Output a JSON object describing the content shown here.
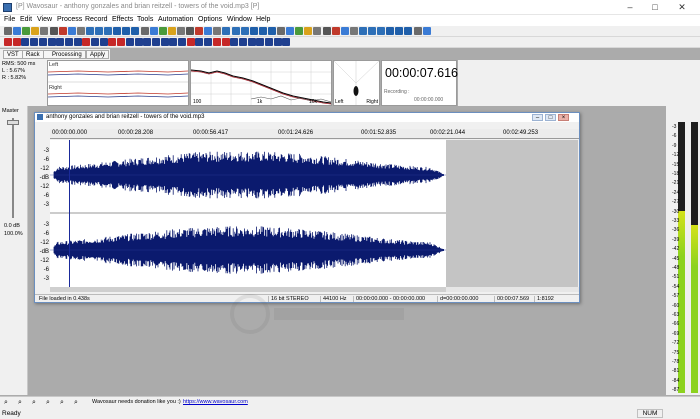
{
  "app": {
    "title": "[P] Wavosaur - anthony gonzales and brian reitzell - towers of the void.mp3 [P]"
  },
  "menu": [
    "File",
    "Edit",
    "View",
    "Process",
    "Record",
    "Effects",
    "Tools",
    "Automation",
    "Options",
    "Window",
    "Help"
  ],
  "tabs": {
    "vst": "VST",
    "rack": "Rack",
    "processing": "Processing",
    "apply": "Apply"
  },
  "rms": {
    "line1": "RMS: 500 ms",
    "line2": "L : 5.67%",
    "line3": "R : 5.82%"
  },
  "meter": {
    "left": "Left",
    "right": "Right"
  },
  "spectrum": {
    "tick1": "100",
    "tick2": "1k",
    "tick3": "10k"
  },
  "phase": {
    "left": "Left",
    "right": "Right"
  },
  "time": {
    "display": "00:00:07.616",
    "recording_label": "Recording :",
    "recording_value": "00:00:00.000"
  },
  "master": {
    "label": "Master",
    "db": "0.0 dB",
    "pct": "100.0%"
  },
  "document": {
    "title": "anthony gonzales and brian reitzell - towers of the void.mp3",
    "ruler": [
      "00:00:00.000",
      "00:00:28.208",
      "00:00:56.417",
      "00:01:24.626",
      "00:01:52.835",
      "00:02:21.044",
      "00:02:49.253"
    ],
    "db_top": [
      "-3",
      "-6",
      "-12",
      "-dB",
      "-12",
      "-6",
      "-3"
    ],
    "db_bottom": [
      "-3",
      "-6",
      "-12",
      "-dB",
      "-12",
      "-6",
      "-3"
    ],
    "status": {
      "loaded": "File loaded in 0.438s",
      "format": "16 bit  STEREO",
      "rate": "44100 Hz",
      "selection": "00:00:00.000 - 00:00:00.000",
      "cursor": "d=00:00:00.000",
      "position": "00:00:07.569",
      "zoom": "1:8192"
    }
  },
  "vu_scale": [
    "-3",
    "-6",
    "-9",
    "-12",
    "-15",
    "-18",
    "-21",
    "-24",
    "-27",
    "-30",
    "-33",
    "-36",
    "-39",
    "-42",
    "-45",
    "-48",
    "-51",
    "-54",
    "-57",
    "-60",
    "-63",
    "-66",
    "-69",
    "-72",
    "-75",
    "-78",
    "-81",
    "-84",
    "-87"
  ],
  "vu_levels": {
    "left": 0.67,
    "right": 0.62
  },
  "bottom": {
    "message": "Wavosaur needs donation like you :)",
    "link": "https://www.wavosaur.com"
  },
  "status": {
    "ready": "Ready",
    "num": "NUM"
  },
  "colors": {
    "wave": "#0b1a6e",
    "vu_green": "#8cd21e",
    "vu_yellow": "#d4e21a"
  }
}
